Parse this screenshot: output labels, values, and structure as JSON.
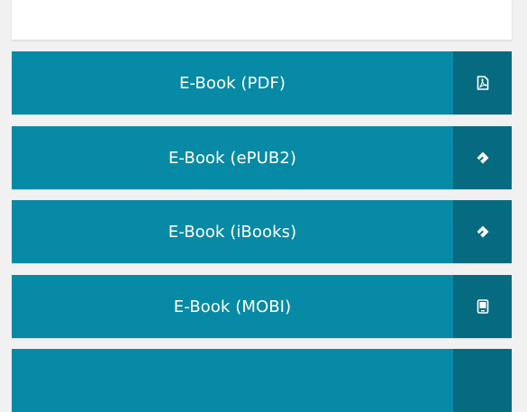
{
  "downloads": [
    {
      "label": "E-Book (PDF)",
      "icon": "pdf-file-icon"
    },
    {
      "label": "E-Book (ePUB2)",
      "icon": "epub-icon"
    },
    {
      "label": "E-Book (iBooks)",
      "icon": "epub-icon"
    },
    {
      "label": "E-Book (MOBI)",
      "icon": "kindle-device-icon"
    }
  ],
  "colors": {
    "button_bg": "#078aa5",
    "icon_bg": "#066b80",
    "text": "#ffffff"
  }
}
